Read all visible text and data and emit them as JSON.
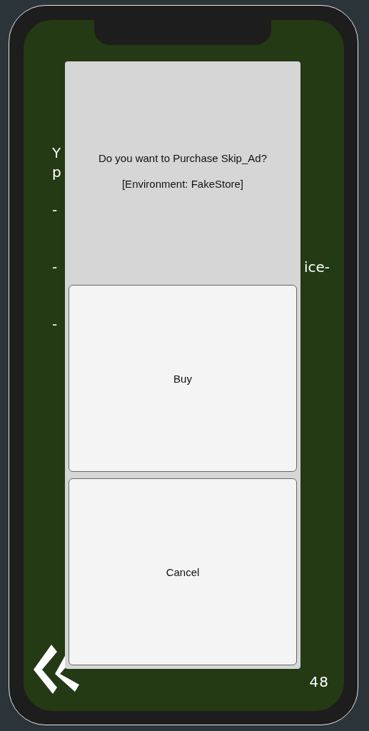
{
  "background_text": [
    {
      "kind": "wrap",
      "left": "Y"
    },
    {
      "kind": "wrap",
      "left": "p"
    },
    {
      "kind": "paragraph",
      "left": "-"
    },
    {
      "kind": "after_two_lines",
      "left": "-",
      "right": "ice-"
    },
    {
      "kind": "after_two_lines",
      "left": "-"
    }
  ],
  "dialog": {
    "message": "Do you want to Purchase Skip_Ad?",
    "environment": "[Environment: FakeStore]",
    "buttons": [
      {
        "label": "Buy"
      },
      {
        "label": "Cancel"
      }
    ]
  },
  "page_number": "48"
}
